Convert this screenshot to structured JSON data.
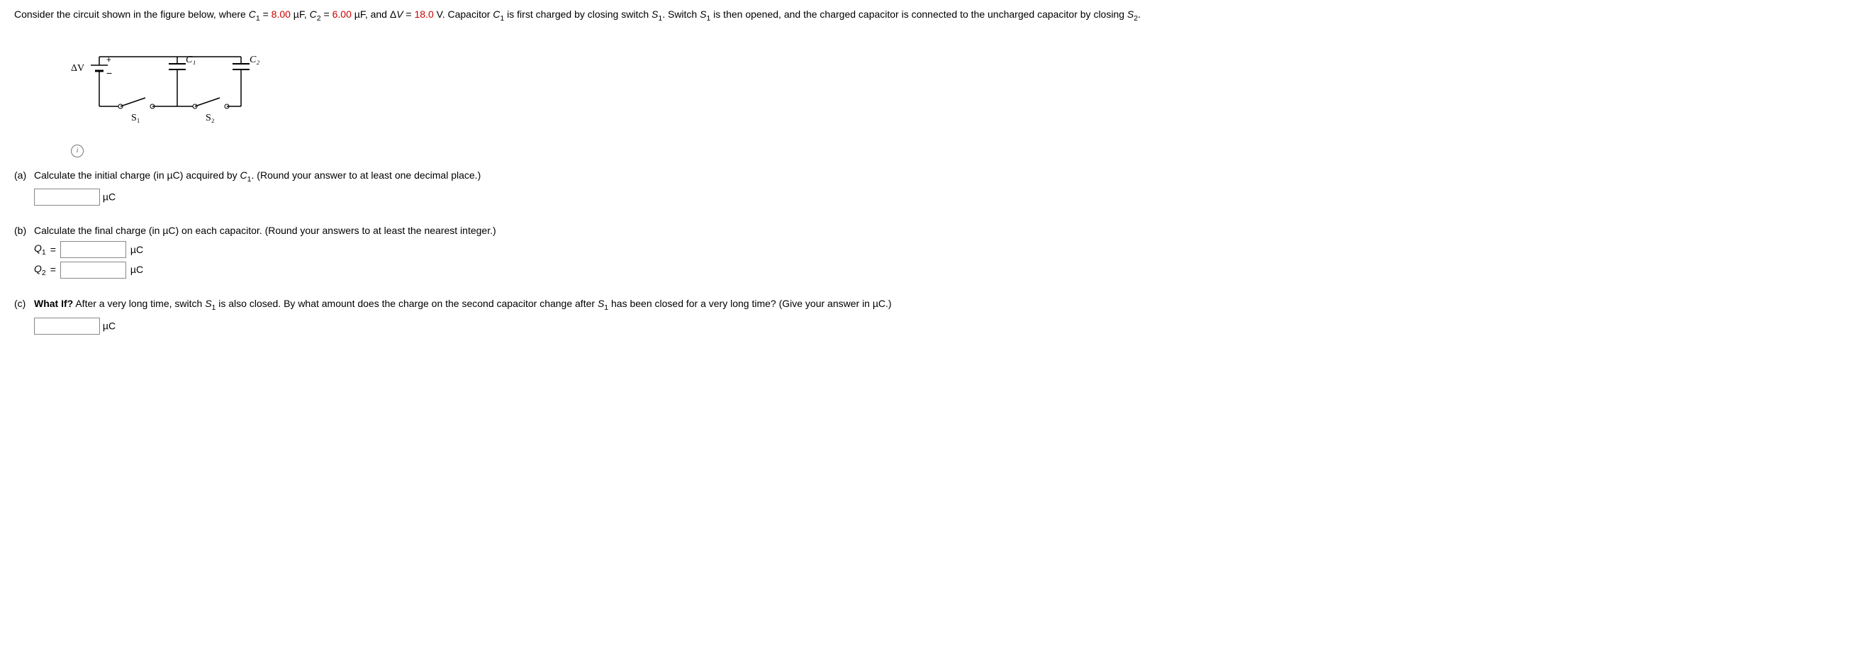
{
  "intro": {
    "p1a": "Consider the circuit shown in the figure below, where ",
    "C1_sym": "C",
    "C1_sub": "1",
    "eq1": " = ",
    "C1_val": "8.00",
    "C1_unit": " µF, ",
    "C2_sym": "C",
    "C2_sub": "2",
    "eq2": " = ",
    "C2_val": "6.00",
    "C2_unit": " µF, and Δ",
    "V_sym": "V",
    "eq3": " = ",
    "V_val": "18.0",
    "V_unit": " V. Capacitor ",
    "C1b_sym": "C",
    "C1b_sub": "1",
    "p1b": " is first charged by closing switch ",
    "S1_sym": "S",
    "S1_sub": "1",
    "p1c": ". Switch ",
    "S1b_sym": "S",
    "S1b_sub": "1",
    "p1d": " is then opened, and the charged capacitor is connected to the uncharged capacitor by closing ",
    "S2_sym": "S",
    "S2_sub": "2",
    "p1e": "."
  },
  "figure": {
    "dV": "ΔV",
    "plus": "+",
    "minus": "−",
    "C1": "C₁",
    "C2": "C₂",
    "S1": "S₁",
    "S2": "S₂"
  },
  "partA": {
    "label": "(a)",
    "text1": "Calculate the initial charge (in µC) acquired by ",
    "Csym": "C",
    "Csub": "1",
    "text2": ". (Round your answer to at least one decimal place.)",
    "unit": "µC"
  },
  "partB": {
    "label": "(b)",
    "text": "Calculate the final charge (in µC) on each capacitor. (Round your answers to at least the nearest integer.)",
    "Q1_sym": "Q",
    "Q1_sub": "1",
    "Q2_sym": "Q",
    "Q2_sub": "2",
    "eq": "=",
    "unit": "µC"
  },
  "partC": {
    "label": "(c)",
    "whatif": "What If?",
    "t1": " After a very long time, switch ",
    "S1_sym": "S",
    "S1_sub": "1",
    "t2": " is also closed. By what amount does the charge on the second capacitor change after ",
    "S1b_sym": "S",
    "S1b_sub": "1",
    "t3": " has been closed for a very long time? (Give your answer in µC.)",
    "unit": "µC"
  }
}
